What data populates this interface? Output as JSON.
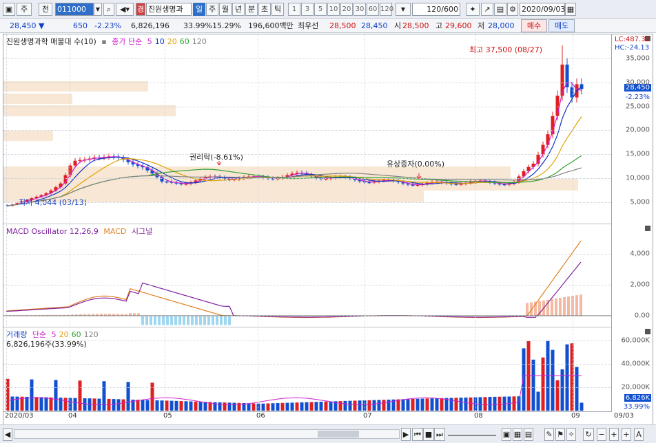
{
  "toolbar": {
    "market_label": "주",
    "prev_label": "전",
    "code_value": "011000",
    "company_label": "진원생명과",
    "periods": [
      "일",
      "주",
      "월",
      "년",
      "분",
      "초",
      "틱"
    ],
    "active_period": "일",
    "intervals": [
      "1",
      "3",
      "5",
      "10",
      "20",
      "30",
      "60",
      "120"
    ],
    "count_value": "120/600",
    "date_value": "2020/09/03"
  },
  "quote": {
    "price": "28,450",
    "change": "650",
    "change_pct": "-2.23%",
    "volume": "6,826,196",
    "vol_ratio": "33.99%",
    "turnover": "15.29%",
    "amount": "196,600백만",
    "priority_label": "최우선",
    "ask": "28,500",
    "bid": "28,450",
    "open_label": "시",
    "open": "28,500",
    "high_label": "고",
    "high": "29,600",
    "low_label": "저",
    "low": "28,000",
    "buy_label": "매수",
    "sell_label": "매도"
  },
  "price_pane": {
    "title": "진원생명과학 매물대 수(10)",
    "ma_label": "종가 단순",
    "ma_periods": [
      "5",
      "10",
      "20",
      "60",
      "120"
    ],
    "ma_colors": [
      "#d020d0",
      "#1030c0",
      "#e0a000",
      "#30a030",
      "#808080"
    ],
    "lc_label": "LC:487.32",
    "hc_label": "HC:-24.13",
    "y_labels": [
      "35,000",
      "30,000",
      "25,000",
      "20,000",
      "15,000",
      "10,000",
      "5,000"
    ],
    "current_price_tag": "28,450",
    "current_pct_tag": "-2.23%",
    "high_note": "최고 37,500 (08/27)",
    "low_note": "최저 4,044 (03/13)",
    "event1": "권리락(-8.61%)",
    "event2": "유상증자(0.00%)"
  },
  "macd_pane": {
    "title": "MACD Oscillator 12,26,9",
    "macd_label": "MACD",
    "signal_label": "시그널",
    "y_labels": [
      "4,000",
      "2,000",
      "0.00"
    ]
  },
  "volume_pane": {
    "title": "거래량",
    "ma_label": "단순",
    "ma_periods": [
      "5",
      "20",
      "60",
      "120"
    ],
    "ma_colors": [
      "#d020d0",
      "#e0a000",
      "#30a030",
      "#808080"
    ],
    "value_label": "6,826,196주(33.99%)",
    "y_labels": [
      "60,000K",
      "40,000K",
      "20,000K"
    ],
    "current_tag": "6,826K",
    "current_pct_tag": "33.99%"
  },
  "x_labels": [
    "2020/03",
    "04",
    "05",
    "06",
    "07",
    "08",
    "09",
    "09/03"
  ],
  "colors": {
    "up": "#e02020",
    "down": "#1050d0",
    "band": "#f7e7d4",
    "macd": "#e08020",
    "signal": "#8020a0"
  },
  "chart_data": {
    "type": "candlestick",
    "title": "진원생명과학",
    "high": {
      "value": 37500,
      "date": "08/27"
    },
    "low": {
      "value": 4044,
      "date": "03/13"
    },
    "last": {
      "close": 28450,
      "change_pct": -2.23,
      "volume": 6826196
    },
    "ylim_price": [
      2000,
      40000
    ],
    "ylim_macd": [
      -1000,
      5500
    ],
    "ylim_volume": [
      0,
      70000000
    ],
    "monthly_close_estimate": {
      "x": [
        "2020/03",
        "04",
        "05",
        "06",
        "07",
        "08",
        "09"
      ],
      "y": [
        6000,
        13000,
        9500,
        9500,
        9000,
        9500,
        28450
      ]
    }
  }
}
